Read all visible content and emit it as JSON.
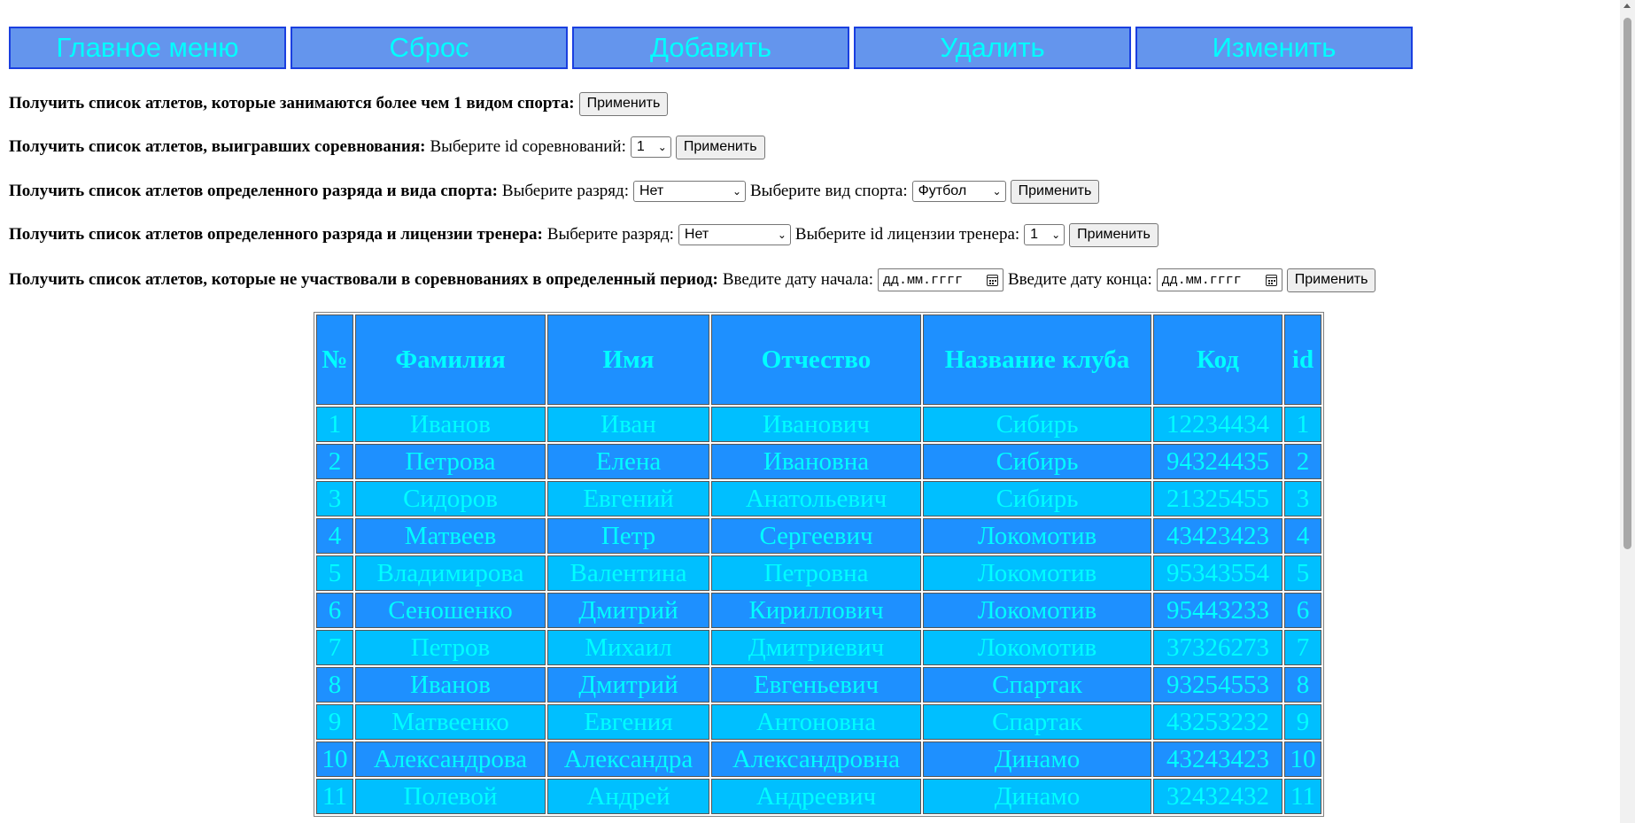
{
  "nav": {
    "buttons": [
      {
        "label": "Главное меню"
      },
      {
        "label": "Сброс"
      },
      {
        "label": "Добавить"
      },
      {
        "label": "Удалить"
      },
      {
        "label": "Изменить"
      }
    ]
  },
  "queries": {
    "q1": {
      "title": "Получить список атлетов, которые занимаются более чем 1 видом спорта:",
      "apply": "Применить"
    },
    "q2": {
      "title": "Получить список атлетов, выигравших соревнования:",
      "label": "Выберите id соревнований:",
      "select": "1",
      "apply": "Применить"
    },
    "q3": {
      "title": "Получить список атлетов определенного разряда и вида спорта:",
      "label1": "Выберите разряд:",
      "select1": "Нет",
      "label2": "Выберите вид спорта:",
      "select2": "Футбол",
      "apply": "Применить"
    },
    "q4": {
      "title": "Получить список атлетов определенного разряда и лицензии тренера:",
      "label1": "Выберите разряд:",
      "select1": "Нет",
      "label2": "Выберите id лицензии тренера:",
      "select2": "1",
      "apply": "Применить"
    },
    "q5": {
      "title": "Получить список атлетов, которые не участвовали в соревнованиях в определенный период:",
      "label1": "Введите дату начала:",
      "date1_placeholder": "дд.мм.гггг",
      "label2": "Введите дату конца:",
      "date2_placeholder": "дд.мм.гггг",
      "apply": "Применить"
    }
  },
  "table": {
    "headers": [
      "№",
      "Фамилия",
      "Имя",
      "Отчество",
      "Название клуба",
      "Код",
      "id"
    ],
    "rows": [
      [
        "1",
        "Иванов",
        "Иван",
        "Иванович",
        "Сибирь",
        "12234434",
        "1"
      ],
      [
        "2",
        "Петрова",
        "Елена",
        "Ивановна",
        "Сибирь",
        "94324435",
        "2"
      ],
      [
        "3",
        "Сидоров",
        "Евгений",
        "Анатольевич",
        "Сибирь",
        "21325455",
        "3"
      ],
      [
        "4",
        "Матвеев",
        "Петр",
        "Сергеевич",
        "Локомотив",
        "43423423",
        "4"
      ],
      [
        "5",
        "Владимирова",
        "Валентина",
        "Петровна",
        "Локомотив",
        "95343554",
        "5"
      ],
      [
        "6",
        "Сеношенко",
        "Дмитрий",
        "Кириллович",
        "Локомотив",
        "95443233",
        "6"
      ],
      [
        "7",
        "Петров",
        "Михаил",
        "Дмитриевич",
        "Локомотив",
        "37326273",
        "7"
      ],
      [
        "8",
        "Иванов",
        "Дмитрий",
        "Евгеньевич",
        "Спартак",
        "93254553",
        "8"
      ],
      [
        "9",
        "Матвеенко",
        "Евгения",
        "Антоновна",
        "Спартак",
        "43253232",
        "9"
      ],
      [
        "10",
        "Александрова",
        "Александра",
        "Александровна",
        "Динамо",
        "43243423",
        "10"
      ],
      [
        "11",
        "Полевой",
        "Андрей",
        "Андреевич",
        "Динамо",
        "32432432",
        "11"
      ]
    ]
  },
  "colors": {
    "nav_bg": "#6495ED",
    "nav_text": "#00FFFF",
    "header_bg": "#1E90FF",
    "row_light": "#00BFFF",
    "row_dark": "#1E90FF",
    "cell_text": "#00FFFF"
  }
}
